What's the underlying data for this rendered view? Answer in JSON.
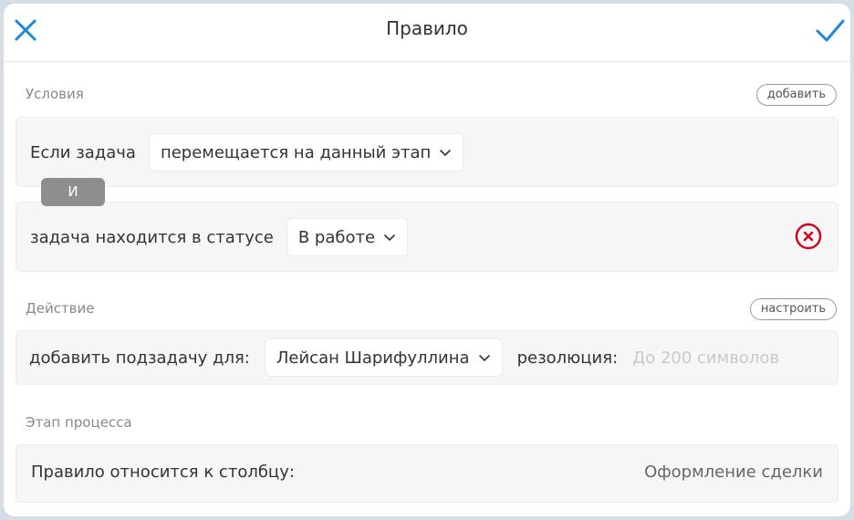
{
  "header": {
    "title": "Правило",
    "close_icon": "close-icon",
    "confirm_icon": "check-icon",
    "accent_color": "#1e88d6"
  },
  "conditions": {
    "label": "Условия",
    "add_button": "добавить",
    "condition1": {
      "prefix": "Если задача",
      "select_value": "перемещается на данный этап"
    },
    "and_badge": "И",
    "condition2": {
      "prefix": "задача находится в статусе",
      "select_value": "В работе",
      "remove_icon": "remove-circle-icon",
      "remove_color": "#d0021b"
    }
  },
  "action": {
    "label": "Действие",
    "configure_button": "настроить",
    "prefix": "добавить подзадачу для:",
    "assignee": "Лейсан Шарифуллина",
    "resolution_label": "резолюция:",
    "resolution_value": "",
    "resolution_placeholder": "До 200 символов"
  },
  "stage": {
    "label": "Этап процесса",
    "prefix": "Правило относится к столбцу:",
    "value": "Оформление сделки"
  }
}
